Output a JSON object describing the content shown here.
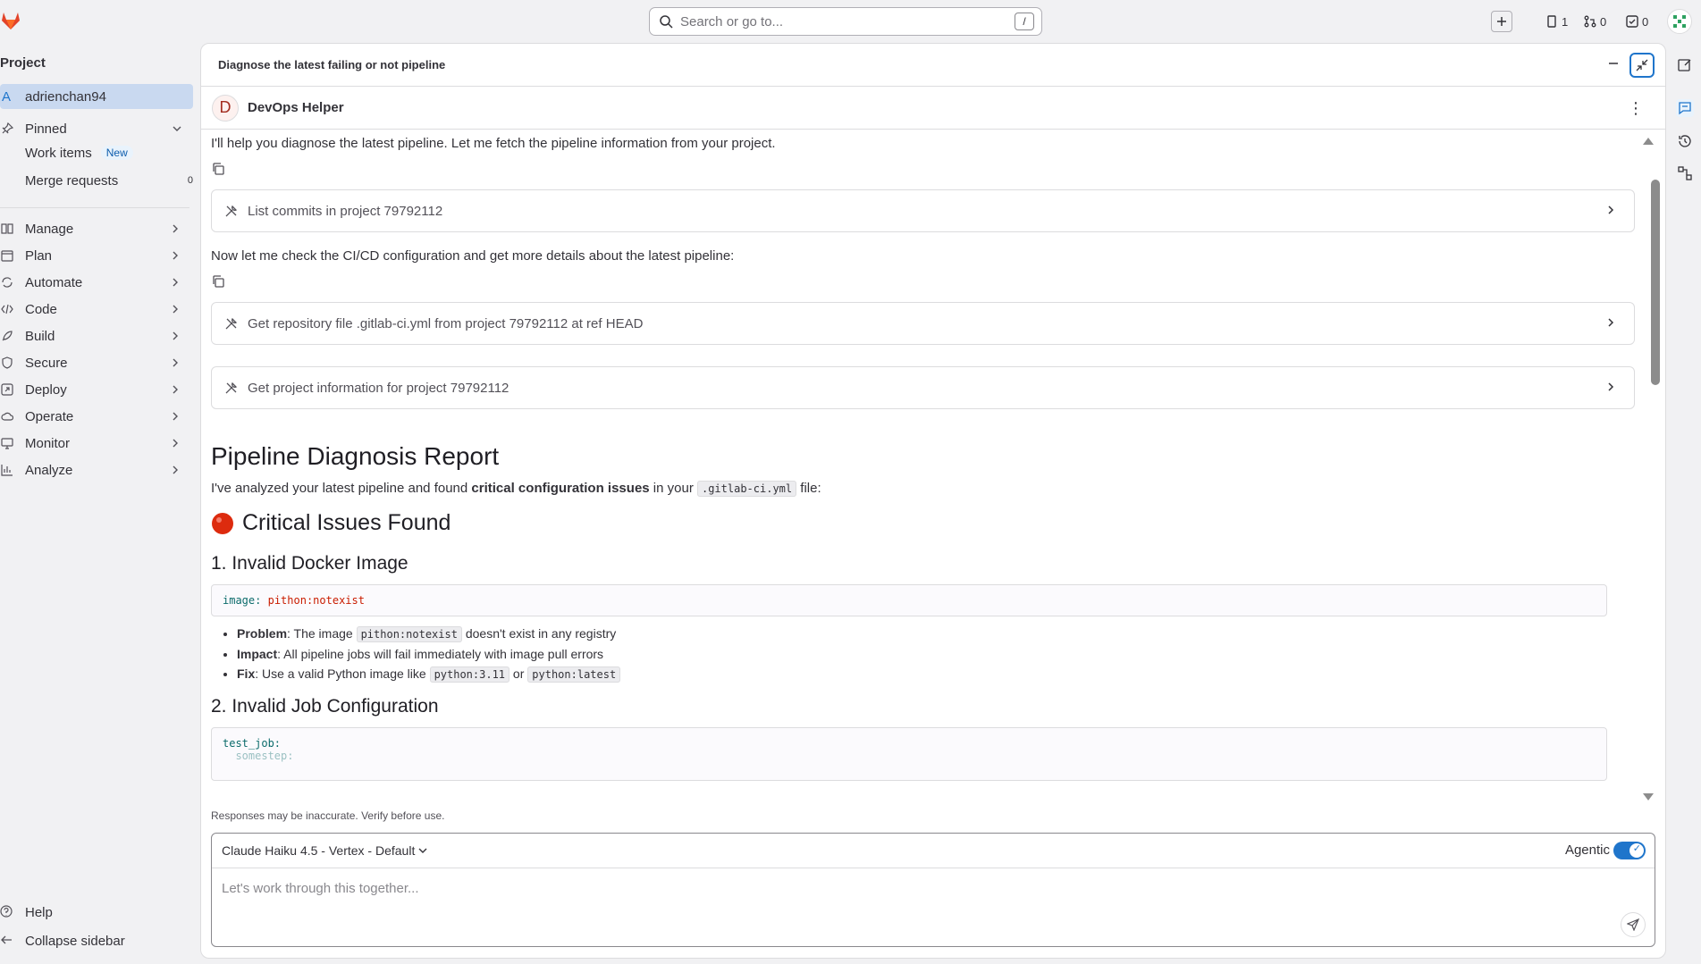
{
  "topbar": {
    "search_placeholder": "Search or go to...",
    "search_shortcut": "/",
    "issues_count": "1",
    "mr_count": "0",
    "todo_count": "0"
  },
  "sidebar": {
    "title": "Project",
    "project_letter": "A",
    "project_name": "adrienchan94",
    "pinned_label": "Pinned",
    "pinned_items": [
      {
        "label": "Work items",
        "badge": "New"
      },
      {
        "label": "Merge requests",
        "count": "0"
      }
    ],
    "nav": [
      "Manage",
      "Plan",
      "Automate",
      "Code",
      "Build",
      "Secure",
      "Deploy",
      "Operate",
      "Monitor",
      "Analyze"
    ],
    "help": "Help",
    "collapse": "Collapse sidebar"
  },
  "panel": {
    "title": "Diagnose the latest failing or not pipeline",
    "agent_letter": "D",
    "agent_name": "DevOps Helper"
  },
  "chat": {
    "msg1": "I'll help you diagnose the latest pipeline. Let me fetch the pipeline information from your project.",
    "tool1": "List commits in project 79792112",
    "msg2": "Now let me check the CI/CD configuration and get more details about the latest pipeline:",
    "tool2": "Get repository file .gitlab-ci.yml from project 79792112 at ref HEAD",
    "tool3": "Get project information for project 79792112",
    "report_title": "Pipeline Diagnosis Report",
    "intro_pre": "I've analyzed your latest pipeline and found ",
    "intro_bold": "critical configuration issues",
    "intro_mid": " in your ",
    "intro_code": ".gitlab-ci.yml",
    "intro_post": " file:",
    "critical_title": "Critical Issues Found",
    "issue1_title": "1. Invalid Docker Image",
    "code1_key": "image:",
    "code1_val": "pithon:notexist",
    "bullets": {
      "b1_label": "Problem",
      "b1_pre": ": The image ",
      "b1_code": "pithon:notexist",
      "b1_post": " doesn't exist in any registry",
      "b2_label": "Impact",
      "b2_text": ": All pipeline jobs will fail immediately with image pull errors",
      "b3_label": "Fix",
      "b3_pre": ": Use a valid Python image like ",
      "b3_code1": "python:3.11",
      "b3_mid": " or ",
      "b3_code2": "python:latest"
    },
    "issue2_title": "2. Invalid Job Configuration",
    "code2_line1": "test_job:",
    "code2_line2": "  somestep:"
  },
  "composer": {
    "disclaimer": "Responses may be inaccurate. Verify before use.",
    "model": "Claude Haiku 4.5 - Vertex - Default",
    "agentic_label": "Agentic",
    "placeholder": "Let's work through this together..."
  },
  "colors": {
    "accent": "#1f75cb",
    "project_highlight": "#c9d9f0",
    "code_key": "#0b6b6b",
    "code_string": "#c91c00",
    "critical_dot": "#dd2b0e"
  }
}
